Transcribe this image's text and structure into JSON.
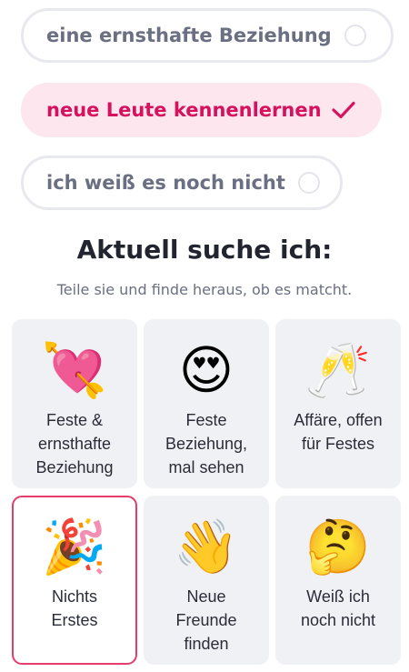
{
  "options": [
    {
      "label": "eine ernsthafte Beziehung",
      "selected": false
    },
    {
      "label": "neue Leute kennenlernen",
      "selected": true
    },
    {
      "label": "ich weiß es noch nicht",
      "selected": false
    }
  ],
  "section": {
    "heading": "Aktuell suche ich:",
    "subheading": "Teile sie und finde heraus, ob es matcht."
  },
  "cards": [
    {
      "emoji": "💘",
      "icon": "heart-with-arrow-icon",
      "label_lines": [
        "Feste &",
        "ernsthafte",
        "Beziehung"
      ],
      "selected": false
    },
    {
      "emoji": "😍",
      "icon": "heart-eyes-face-icon",
      "label_lines": [
        "Feste",
        "Beziehung,",
        "mal sehen"
      ],
      "selected": false
    },
    {
      "emoji": "🥂",
      "icon": "clinking-glasses-icon",
      "label_lines": [
        "Affäre, offen",
        "für Festes"
      ],
      "selected": false
    },
    {
      "emoji": "🎉",
      "icon": "party-popper-icon",
      "label_lines": [
        "Nichts",
        "Erstes"
      ],
      "selected": true
    },
    {
      "emoji": "👋",
      "icon": "waving-hand-icon",
      "label_lines": [
        "Neue",
        "Freunde",
        "finden"
      ],
      "selected": false
    },
    {
      "emoji": "🤔",
      "icon": "thinking-face-icon",
      "label_lines": [
        "Weiß ich",
        "noch nicht"
      ],
      "selected": false
    }
  ],
  "colors": {
    "accent": "#e53d6b",
    "selected_pill_bg": "#fde6ee",
    "selected_pill_text": "#d6125e",
    "card_bg": "#f0f1f4",
    "muted_text": "#6a6f82"
  }
}
